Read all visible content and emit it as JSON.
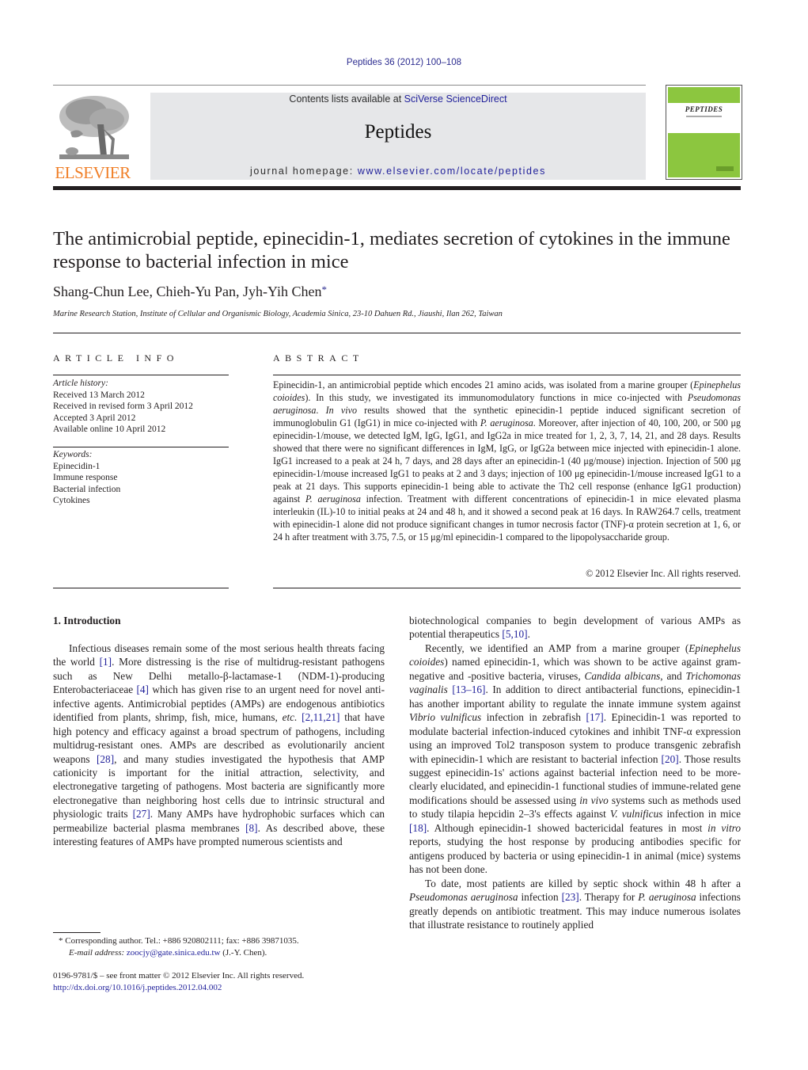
{
  "header": {
    "journal_ref": "Peptides 36 (2012) 100–108",
    "contents_prefix": "Contents lists available at ",
    "contents_link": "SciVerse ScienceDirect",
    "journal_name": "Peptides",
    "homepage_prefix": "journal homepage: ",
    "homepage_link": "www.elsevier.com/locate/peptides",
    "publisher_logo_text": "ELSEVIER",
    "cover_title": "PEPTIDES",
    "colors": {
      "elsevier_orange": "#f07e26",
      "link_blue": "#1f1f9a",
      "cover_green": "#8cc63f",
      "banner_gray": "#e6e7e9"
    }
  },
  "article": {
    "title": "The antimicrobial peptide, epinecidin-1, mediates secretion of cytokines in the immune response to bacterial infection in mice",
    "authors": "Shang-Chun Lee, Chieh-Yu Pan, Jyh-Yih Chen",
    "author_mark": "*",
    "affiliation": "Marine Research Station, Institute of Cellular and Organismic Biology, Academia Sinica, 23-10 Dahuen Rd., Jiaushi, Ilan 262, Taiwan"
  },
  "article_info": {
    "caption": "ARTICLE INFO",
    "history_label": "Article history:",
    "history": [
      "Received 13 March 2012",
      "Received in revised form 3 April 2012",
      "Accepted 3 April 2012",
      "Available online 10 April 2012"
    ],
    "keywords_label": "Keywords:",
    "keywords": [
      "Epinecidin-1",
      "Immune response",
      "Bacterial infection",
      "Cytokines"
    ]
  },
  "abstract": {
    "caption": "ABSTRACT",
    "segments": [
      {
        "t": "Epinecidin-1, an antimicrobial peptide which encodes 21 amino acids, was isolated from a marine grouper ("
      },
      {
        "t": "Epinephelus coioides",
        "i": true
      },
      {
        "t": "). In this study, we investigated its immunomodulatory functions in mice co-injected with "
      },
      {
        "t": "Pseudomonas aeruginosa",
        "i": true
      },
      {
        "t": ". "
      },
      {
        "t": "In vivo",
        "i": true
      },
      {
        "t": " results showed that the synthetic epinecidin-1 peptide induced significant secretion of immunoglobulin G1 (IgG1) in mice co-injected with "
      },
      {
        "t": "P. aeruginosa",
        "i": true
      },
      {
        "t": ". Moreover, after injection of 40, 100, 200, or 500 μg epinecidin-1/mouse, we detected IgM, IgG, IgG1, and IgG2a in mice treated for 1, 2, 3, 7, 14, 21, and 28 days. Results showed that there were no significant differences in IgM, IgG, or IgG2a between mice injected with epinecidin-1 alone. IgG1 increased to a peak at 24 h, 7 days, and 28 days after an epinecidin-1 (40 μg/mouse) injection. Injection of 500 μg epinecidin-1/mouse increased IgG1 to peaks at 2 and 3 days; injection of 100 μg epinecidin-1/mouse increased IgG1 to a peak at 21 days. This supports epinecidin-1 being able to activate the Th2 cell response (enhance IgG1 production) against "
      },
      {
        "t": "P. aeruginosa",
        "i": true
      },
      {
        "t": " infection. Treatment with different concentrations of epinecidin-1 in mice elevated plasma interleukin (IL)-10 to initial peaks at 24 and 48 h, and it showed a second peak at 16 days. In RAW264.7 cells, treatment with epinecidin-1 alone did not produce significant changes in tumor necrosis factor (TNF)-α protein secretion at 1, 6, or 24 h after treatment with 3.75, 7.5, or 15 μg/ml epinecidin-1 compared to the lipopolysaccharide group."
      }
    ],
    "copyright": "© 2012 Elsevier Inc. All rights reserved."
  },
  "body": {
    "section_heading": "1.  Introduction",
    "col1_paragraphs": [
      {
        "indent": true,
        "segments": [
          {
            "t": "Infectious diseases remain some of the most serious health threats facing the world "
          },
          {
            "t": "[1]",
            "ref": true
          },
          {
            "t": ". More distressing is the rise of multidrug-resistant pathogens such as New Delhi metallo-β-lactamase-1 (NDM-1)-producing Enterobacteriaceae "
          },
          {
            "t": "[4]",
            "ref": true
          },
          {
            "t": " which has given rise to an urgent need for novel anti-infective agents. Antimicrobial peptides (AMPs) are endogenous antibiotics identified from plants, shrimp, fish, mice, humans, "
          },
          {
            "t": "etc.",
            "i": true
          },
          {
            "t": " "
          },
          {
            "t": "[2,11,21]",
            "ref": true
          },
          {
            "t": " that have high potency and efficacy against a broad spectrum of pathogens, including multidrug-resistant ones. AMPs are described as evolutionarily ancient weapons "
          },
          {
            "t": "[28]",
            "ref": true
          },
          {
            "t": ", and many studies investigated the hypothesis that AMP cationicity is important for the initial attraction, selectivity, and electronegative targeting of pathogens. Most bacteria are significantly more electronegative than neighboring host cells due to intrinsic structural and physiologic traits "
          },
          {
            "t": "[27]",
            "ref": true
          },
          {
            "t": ". Many AMPs have hydrophobic surfaces which can permeabilize bacterial plasma membranes "
          },
          {
            "t": "[8]",
            "ref": true
          },
          {
            "t": ". As described above, these interesting features of AMPs have prompted numerous scientists and"
          }
        ]
      }
    ],
    "col2_paragraphs": [
      {
        "indent": false,
        "segments": [
          {
            "t": "biotechnological companies to begin development of various AMPs as potential therapeutics "
          },
          {
            "t": "[5,10]",
            "ref": true
          },
          {
            "t": "."
          }
        ]
      },
      {
        "indent": true,
        "segments": [
          {
            "t": "Recently, we identified an AMP from a marine grouper ("
          },
          {
            "t": "Epinephelus coioides",
            "i": true
          },
          {
            "t": ") named epinecidin-1, which was shown to be active against gram-negative and -positive bacteria, viruses, "
          },
          {
            "t": "Candida albicans",
            "i": true
          },
          {
            "t": ", and "
          },
          {
            "t": "Trichomonas vaginalis",
            "i": true
          },
          {
            "t": " "
          },
          {
            "t": "[13–16]",
            "ref": true
          },
          {
            "t": ". In addition to direct antibacterial functions, epinecidin-1 has another important ability to regulate the innate immune system against "
          },
          {
            "t": "Vibrio vulnificus",
            "i": true
          },
          {
            "t": " infection in zebrafish "
          },
          {
            "t": "[17]",
            "ref": true
          },
          {
            "t": ". Epinecidin-1 was reported to modulate bacterial infection-induced cytokines and inhibit TNF-α expression using an improved Tol2 transposon system to produce transgenic zebrafish with epinecidin-1 which are resistant to bacterial infection "
          },
          {
            "t": "[20]",
            "ref": true
          },
          {
            "t": ". Those results suggest epinecidin-1s' actions against bacterial infection need to be more-clearly elucidated, and epinecidin-1 functional studies of immune-related gene modifications should be assessed using "
          },
          {
            "t": "in vivo",
            "i": true
          },
          {
            "t": " systems such as methods used to study tilapia hepcidin 2–3's effects against "
          },
          {
            "t": "V. vulnificus",
            "i": true
          },
          {
            "t": " infection in mice "
          },
          {
            "t": "[18]",
            "ref": true
          },
          {
            "t": ". Although epinecidin-1 showed bactericidal features in most "
          },
          {
            "t": "in vitro",
            "i": true
          },
          {
            "t": " reports, studying the host response by producing antibodies specific for antigens produced by bacteria or using epinecidin-1 in animal (mice) systems has not been done."
          }
        ]
      },
      {
        "indent": true,
        "segments": [
          {
            "t": "To date, most patients are killed by septic shock within 48 h after a "
          },
          {
            "t": "Pseudomonas aeruginosa",
            "i": true
          },
          {
            "t": " infection "
          },
          {
            "t": "[23]",
            "ref": true
          },
          {
            "t": ". Therapy for "
          },
          {
            "t": "P. aeruginosa",
            "i": true
          },
          {
            "t": " infections greatly depends on antibiotic treatment. This may induce numerous isolates that illustrate resistance to routinely applied"
          }
        ]
      }
    ]
  },
  "footnotes": {
    "corresponding": "*  Corresponding author. Tel.: +886 920802111; fax: +886 39871035.",
    "email_label": "E-mail address: ",
    "email": "zoocjy@gate.sinica.edu.tw",
    "email_suffix": " (J.-Y. Chen).",
    "issn_line": "0196-9781/$ – see front matter © 2012 Elsevier Inc. All rights reserved.",
    "doi": "http://dx.doi.org/10.1016/j.peptides.2012.04.002"
  }
}
